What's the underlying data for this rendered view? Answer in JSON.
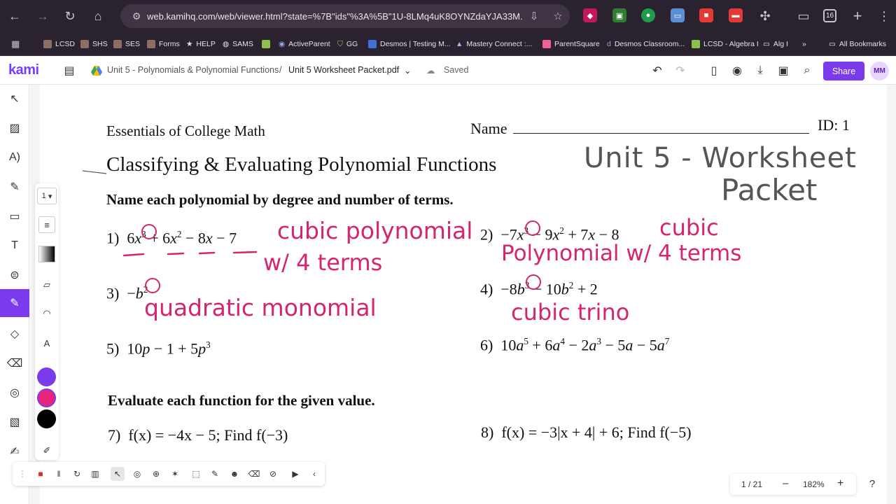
{
  "browser": {
    "url": "web.kamihq.com/web/viewer.html?state=%7B\"ids\"%3A%5B\"1U-8LMq4uK8OYNZdaYJA33M...",
    "tab_count": "16",
    "bookmarks": [
      "LCSD",
      "SHS",
      "SES",
      "Forms",
      "HELP",
      "SAMS",
      "",
      "ActiveParent",
      "GG",
      "Desmos | Testing M...",
      "Mastery Connect :...",
      "ParentSquare",
      "Desmos Classroom...",
      "LCSD - Algebra I",
      "Alg I",
      "»",
      "All Bookmarks"
    ]
  },
  "kami": {
    "logo": "kami",
    "breadcrumb_folder": "Unit 5 - Polynomials & Polynomial Functions",
    "separator": "/",
    "file_name": "Unit 5 Worksheet Packet.pdf",
    "saved_label": "Saved",
    "share_label": "Share",
    "avatar_initials": "MM",
    "page_select": "1",
    "page_indicator": "1 / 21",
    "zoom": "182%",
    "minus": "–",
    "plus": "+",
    "help": "?",
    "accent": "#7c3aed",
    "swatches": [
      "#7c3aed",
      "#e6247a",
      "#000000"
    ]
  },
  "worksheet": {
    "course": "Essentials of College Math",
    "name_label": "Name",
    "id_label": "ID: 1",
    "title": "Classifying & Evaluating Polynomial Functions",
    "instructions_1": "Name each polynomial by degree and number of terms.",
    "instructions_2": "Evaluate each function for the given value.",
    "p1_num": "1)",
    "p2_num": "2)",
    "p3_num": "3)",
    "p4_num": "4)",
    "p5_num": "5)",
    "p6_num": "6)",
    "p7_num": "7)",
    "p8_num": "8)",
    "p7_text": "f(x) = −4x − 5; Find f(−3)",
    "p8_text": "f(x) = −3|x + 4| + 6; Find f(−5)"
  },
  "handwriting": {
    "heading_line1": "Unit 5 - Worksheet",
    "heading_line2": "Packet",
    "a1_line1": "cubic polynomial",
    "a1_line2": "w/ 4 terms",
    "a2_line1": "cubic",
    "a2_line2": "Polynomial w/ 4 terms",
    "a3": "quadratic monomial",
    "a4": "cubic trino"
  }
}
